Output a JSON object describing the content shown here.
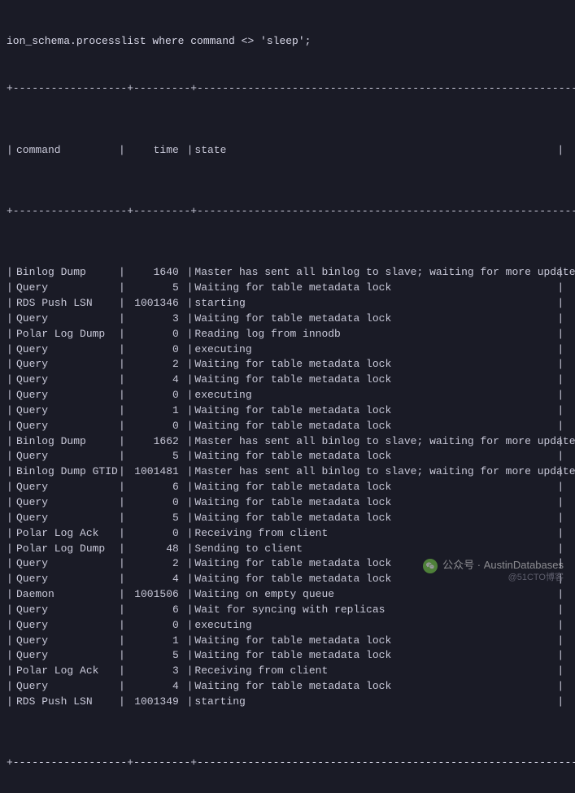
{
  "query_fragment": "ion_schema.processlist where command <> 'sleep';",
  "border_top": "+------------------+---------+---------------------------------------------------------------+",
  "border_mid": "+------------------+---------+---------------------------------------------------------------+",
  "headers": {
    "command": "command",
    "time": "time",
    "state": "state"
  },
  "rows": [
    {
      "command": "Binlog Dump",
      "time": "1640",
      "state": "Master has sent all binlog to slave; waiting for more updates"
    },
    {
      "command": "Query",
      "time": "5",
      "state": "Waiting for table metadata lock"
    },
    {
      "command": "RDS Push LSN",
      "time": "1001346",
      "state": "starting"
    },
    {
      "command": "Query",
      "time": "3",
      "state": "Waiting for table metadata lock"
    },
    {
      "command": "Polar Log Dump",
      "time": "0",
      "state": "Reading log from innodb"
    },
    {
      "command": "Query",
      "time": "0",
      "state": "executing"
    },
    {
      "command": "Query",
      "time": "2",
      "state": "Waiting for table metadata lock"
    },
    {
      "command": "Query",
      "time": "4",
      "state": "Waiting for table metadata lock"
    },
    {
      "command": "Query",
      "time": "0",
      "state": "executing"
    },
    {
      "command": "Query",
      "time": "1",
      "state": "Waiting for table metadata lock"
    },
    {
      "command": "Query",
      "time": "0",
      "state": "Waiting for table metadata lock"
    },
    {
      "command": "Binlog Dump",
      "time": "1662",
      "state": "Master has sent all binlog to slave; waiting for more updates"
    },
    {
      "command": "Query",
      "time": "5",
      "state": "Waiting for table metadata lock"
    },
    {
      "command": "Binlog Dump GTID",
      "time": "1001481",
      "state": "Master has sent all binlog to slave; waiting for more updates"
    },
    {
      "command": "Query",
      "time": "6",
      "state": "Waiting for table metadata lock"
    },
    {
      "command": "Query",
      "time": "0",
      "state": "Waiting for table metadata lock"
    },
    {
      "command": "Query",
      "time": "5",
      "state": "Waiting for table metadata lock"
    },
    {
      "command": "Polar Log Ack",
      "time": "0",
      "state": "Receiving from client"
    },
    {
      "command": "Polar Log Dump",
      "time": "48",
      "state": "Sending to client"
    },
    {
      "command": "Query",
      "time": "2",
      "state": "Waiting for table metadata lock"
    },
    {
      "command": "Query",
      "time": "4",
      "state": "Waiting for table metadata lock"
    },
    {
      "command": "Daemon",
      "time": "1001506",
      "state": "Waiting on empty queue"
    },
    {
      "command": "Query",
      "time": "6",
      "state": "Wait for syncing with replicas"
    },
    {
      "command": "Query",
      "time": "0",
      "state": "executing"
    },
    {
      "command": "Query",
      "time": "1",
      "state": "Waiting for table metadata lock"
    },
    {
      "command": "Query",
      "time": "5",
      "state": "Waiting for table metadata lock"
    },
    {
      "command": "Polar Log Ack",
      "time": "3",
      "state": "Receiving from client"
    },
    {
      "command": "Query",
      "time": "4",
      "state": "Waiting for table metadata lock"
    },
    {
      "command": "RDS Push LSN",
      "time": "1001349",
      "state": "starting"
    }
  ],
  "watermark": {
    "label": "公众号 · AustinDatabases",
    "sub": "@51CTO博客"
  }
}
